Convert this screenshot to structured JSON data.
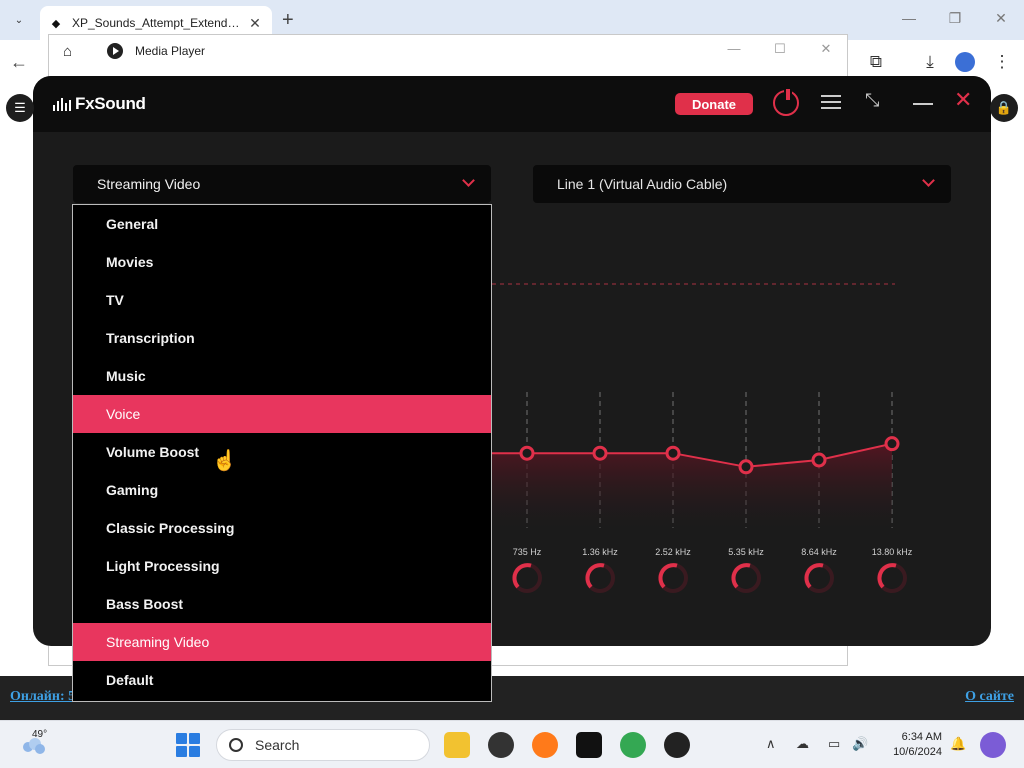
{
  "browser": {
    "tab_title": "XP_Sounds_Attempt_Extended_",
    "tab_close": "✕",
    "new_tab": "+",
    "tab_list": "⌄"
  },
  "media_player": {
    "title": "Media Player"
  },
  "page": {
    "link_left": "Онлайн: 5",
    "link_right": "О сайте"
  },
  "fxsound": {
    "brand": "FxSound",
    "donate_label": "Donate",
    "preset_selected": "Streaming Video",
    "output_device": "Line 1 (Virtual Audio Cable)",
    "accent_color": "#e0304a",
    "eq": {
      "bands": [
        "735 Hz",
        "1.36 kHz",
        "2.52 kHz",
        "5.35 kHz",
        "8.64 kHz",
        "13.80 kHz"
      ],
      "levels": [
        0.55,
        0.55,
        0.55,
        0.45,
        0.5,
        0.62
      ]
    },
    "preset_options": [
      {
        "label": "General",
        "active": false
      },
      {
        "label": "Movies",
        "active": false
      },
      {
        "label": "TV",
        "active": false
      },
      {
        "label": "Transcription",
        "active": false
      },
      {
        "label": "Music",
        "active": false
      },
      {
        "label": "Voice",
        "active": true
      },
      {
        "label": "Volume Boost",
        "active": false
      },
      {
        "label": "Gaming",
        "active": false
      },
      {
        "label": "Classic Processing",
        "active": false
      },
      {
        "label": "Light Processing",
        "active": false
      },
      {
        "label": "Bass Boost",
        "active": false
      },
      {
        "label": "Streaming Video",
        "active": true
      },
      {
        "label": "Default",
        "active": false
      }
    ]
  },
  "taskbar": {
    "temperature": "49°",
    "search_placeholder": "Search",
    "time": "6:34 AM",
    "date": "10/6/2024"
  }
}
